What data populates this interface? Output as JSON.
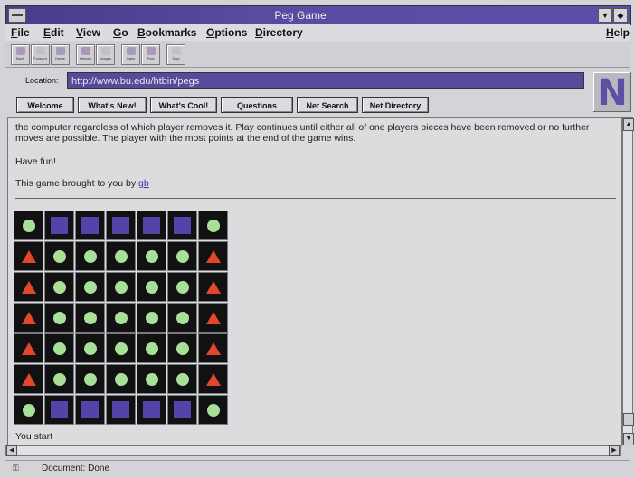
{
  "window": {
    "title": "Peg Game"
  },
  "menu": {
    "file": "File",
    "edit": "Edit",
    "view": "View",
    "go": "Go",
    "bookmarks": "Bookmarks",
    "options": "Options",
    "directory": "Directory",
    "help": "Help"
  },
  "toolbar": {
    "back": "Back",
    "forward": "Forward",
    "home": "Home",
    "reload": "Reload",
    "images": "Images",
    "open": "Open",
    "find": "Find",
    "stop": "Stop"
  },
  "location": {
    "label": "Location:",
    "url": "http://www.bu.edu/htbin/pegs"
  },
  "directory_buttons": [
    "Welcome",
    "What's New!",
    "What's Cool!",
    "Questions",
    "Net Search",
    "Net Directory"
  ],
  "content": {
    "rules_text": "the computer regardless of which player removes it. Play continues until either all of one players pieces have been removed or no further moves are possible. The player with the most points at the end of the game wins.",
    "have_fun": "Have fun!",
    "credit_prefix": "This game brought to you by ",
    "credit_link": "gb",
    "board": [
      [
        "peg",
        "blue",
        "blue",
        "blue",
        "blue",
        "blue",
        "peg"
      ],
      [
        "red",
        "peg",
        "peg",
        "peg",
        "peg",
        "peg",
        "red"
      ],
      [
        "red",
        "peg",
        "peg",
        "peg",
        "peg",
        "peg",
        "red"
      ],
      [
        "red",
        "peg",
        "peg",
        "peg",
        "peg",
        "peg",
        "red"
      ],
      [
        "red",
        "peg",
        "peg",
        "peg",
        "peg",
        "peg",
        "red"
      ],
      [
        "red",
        "peg",
        "peg",
        "peg",
        "peg",
        "peg",
        "red"
      ],
      [
        "peg",
        "blue",
        "blue",
        "blue",
        "blue",
        "blue",
        "peg"
      ]
    ],
    "you_start": "You start"
  },
  "status": {
    "text": "Document: Done"
  },
  "logo": "N"
}
